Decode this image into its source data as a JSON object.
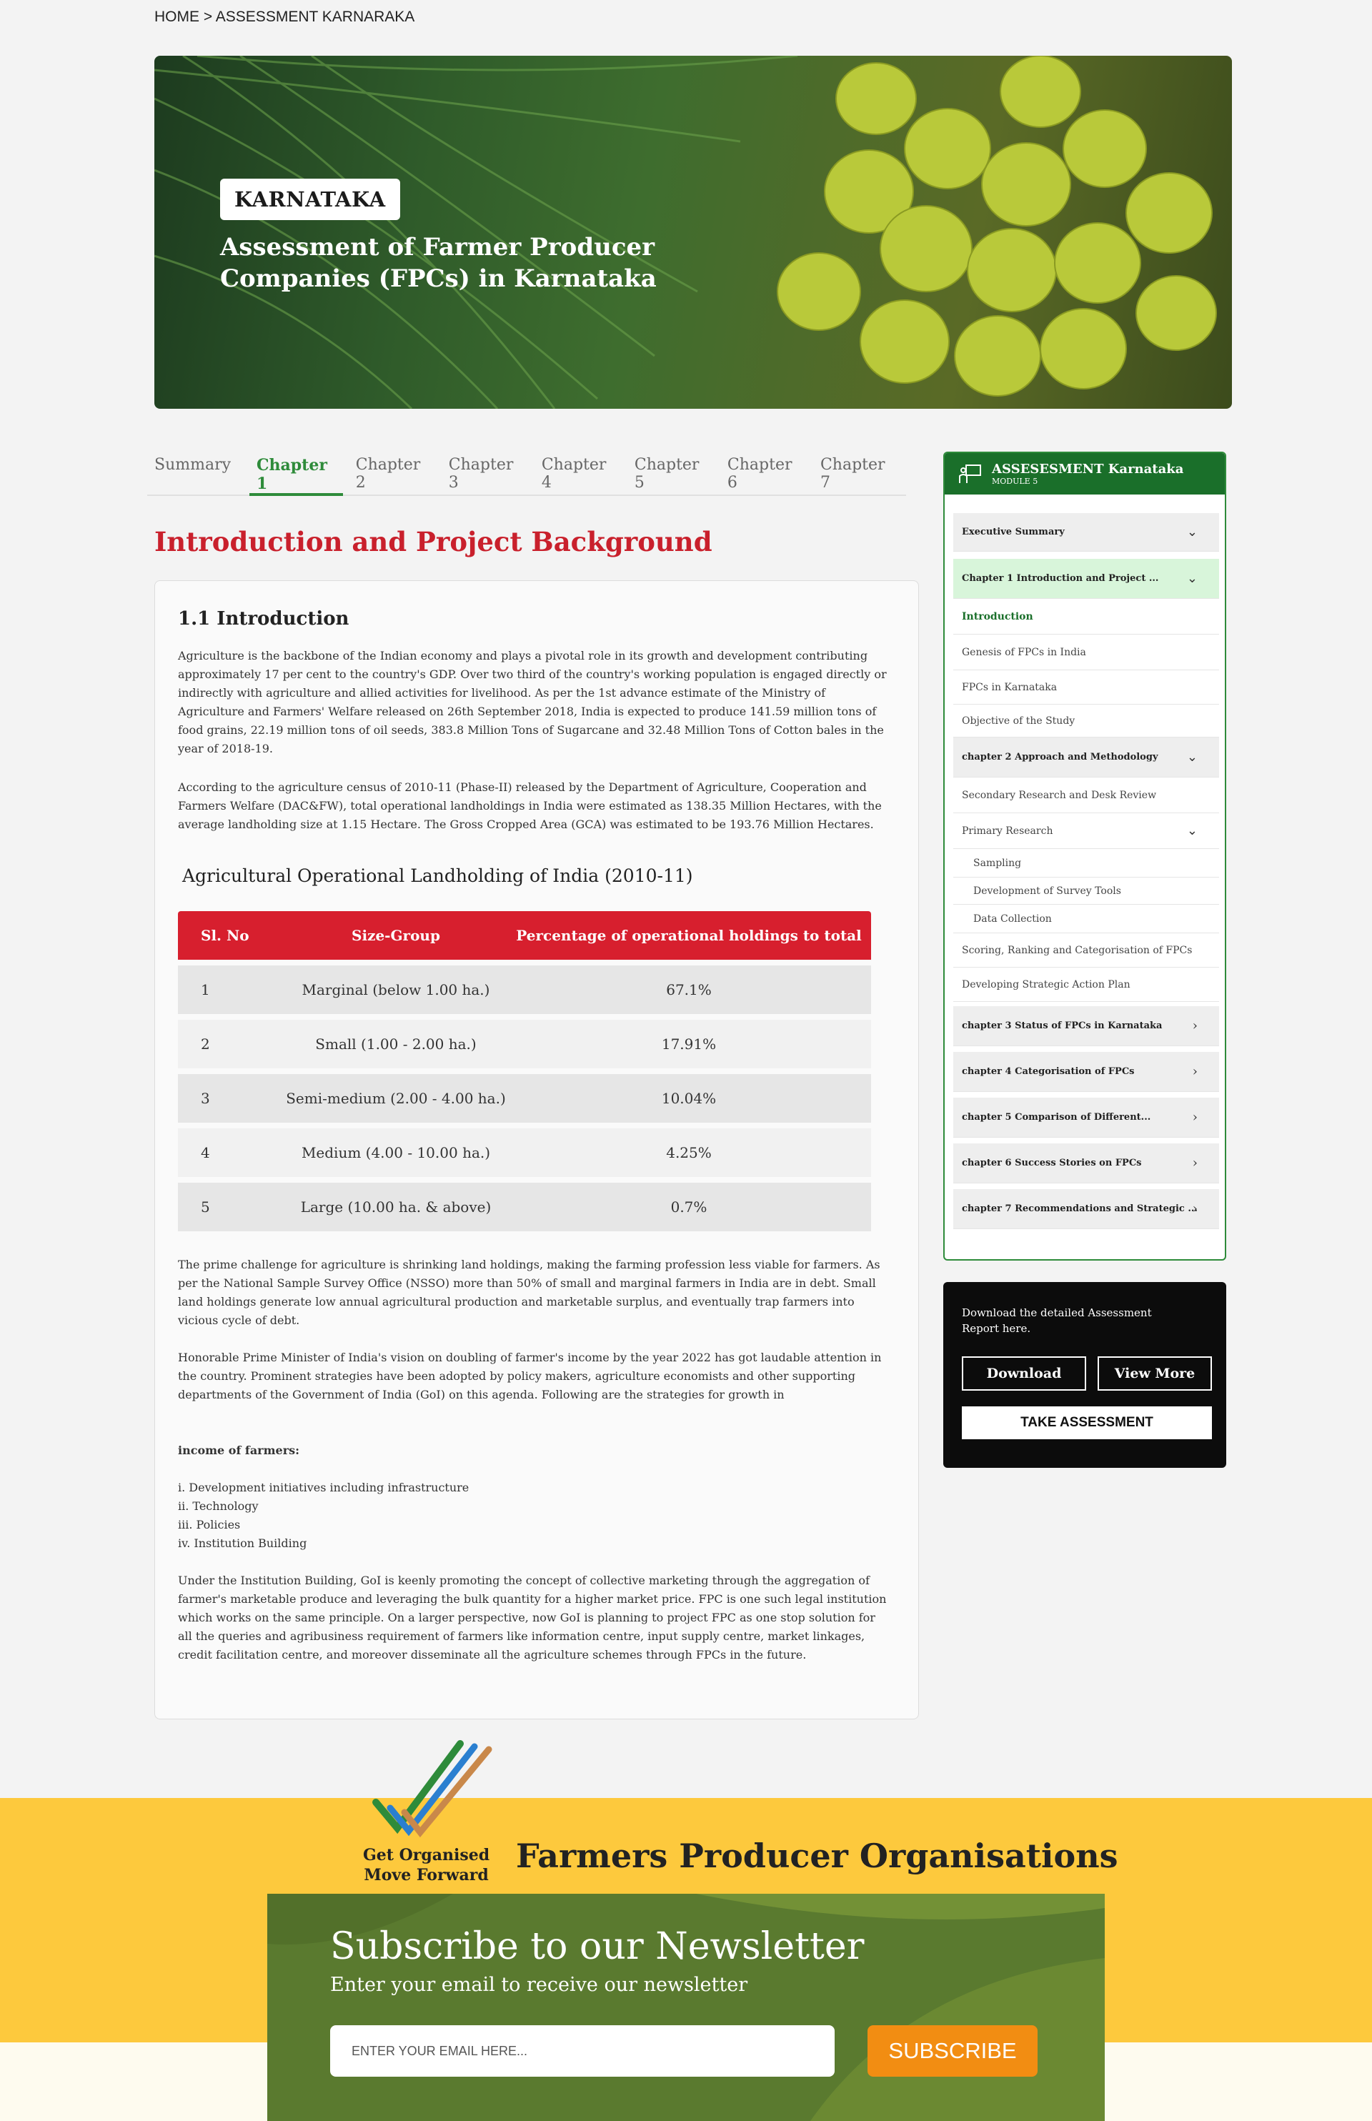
{
  "breadcrumb": {
    "home": "HOME",
    "separator": " > ",
    "current": "ASSESSMENT KARNARAKA"
  },
  "hero": {
    "tag": "KARNATAKA",
    "title": "Assessment of Farmer Producer Companies (FPCs) in Karnataka"
  },
  "tabs": [
    {
      "label": "Summary"
    },
    {
      "label": "Chapter 1"
    },
    {
      "label": "Chapter 2"
    },
    {
      "label": "Chapter 3"
    },
    {
      "label": "Chapter 4"
    },
    {
      "label": "Chapter 5"
    },
    {
      "label": "Chapter 6"
    },
    {
      "label": "Chapter 7"
    }
  ],
  "active_tab": "Chapter 1",
  "main": {
    "section_title": "Introduction and Project Background",
    "subtitle": "1.1 Introduction",
    "para1": "Agriculture is the backbone of the Indian economy and plays a pivotal role in its growth and development contributing approximately 17 per cent to the country's GDP. Over two third of the country's working population is engaged directly or indirectly with agriculture and allied activities for livelihood. As per the 1st advance estimate of the Ministry of Agriculture and Farmers' Welfare released on 26th September 2018, India is expected to produce 141.59 million tons of food grains, 22.19 million tons of oil seeds, 383.8 Million Tons of Sugarcane and 32.48 Million Tons of Cotton bales in the year of 2018-19.",
    "para2": "According to the agriculture census of 2010-11 (Phase-II) released by the Department of Agriculture, Cooperation and Farmers Welfare (DAC&FW), total operational landholdings in India were estimated as 138.35 Million Hectares, with the average landholding size at 1.15 Hectare. The Gross Cropped Area (GCA) was estimated to be 193.76 Million Hectares.",
    "table_title": "Agricultural Operational Landholding of India (2010-11)",
    "table": {
      "headers": [
        "Sl. No",
        "Size-Group",
        "Percentage of operational holdings to total"
      ],
      "rows": [
        [
          "1",
          "Marginal (below 1.00 ha.)",
          "67.1%"
        ],
        [
          "2",
          "Small (1.00 - 2.00 ha.)",
          "17.91%"
        ],
        [
          "3",
          "Semi-medium (2.00 - 4.00 ha.)",
          "10.04%"
        ],
        [
          "4",
          "Medium (4.00 - 10.00 ha.)",
          "4.25%"
        ],
        [
          "5",
          "Large (10.00 ha. & above)",
          "0.7%"
        ]
      ]
    },
    "para3": "The prime challenge for agriculture is shrinking land holdings, making the farming profession less viable for farmers. As per the National Sample Survey Office (NSSO) more than 50% of small and marginal farmers in India are in debt. Small land holdings generate low annual agricultural production and marketable surplus, and eventually trap farmers into vicious cycle of debt.",
    "para4": "Honorable Prime Minister of India's vision on doubling of farmer's income by the year 2022 has got laudable attention in the country. Prominent strategies have been adopted by policy makers, agriculture economists and other supporting departments of the Government of India (GoI) on this agenda. Following are the strategies for growth in",
    "income_heading": "income of farmers:",
    "strategies": [
      "i.  Development initiatives including infrastructure",
      "ii. Technology",
      "iii. Policies",
      "iv. Institution Building"
    ],
    "para5": "Under the Institution Building, GoI is keenly promoting the concept of collective marketing through the aggregation of farmer's marketable produce and leveraging the bulk quantity for a higher market price. FPC is one such legal institution which works on the same principle. On a larger perspective, now GoI is planning to project FPC as one stop solution for all the queries and agribusiness requirement of farmers like information centre, input supply centre, market linkages, credit facilitation centre, and moreover disseminate all the agriculture schemes through FPCs in the future."
  },
  "sidebar": {
    "title": "ASSESESMENT Karnataka",
    "subtitle": "MODULE 5",
    "items": [
      {
        "label": "Executive Summary"
      },
      {
        "label": "Chapter 1 Introduction and Project ..."
      },
      {
        "label": "Introduction"
      },
      {
        "label": "Genesis of FPCs in India"
      },
      {
        "label": "FPCs in Karnataka"
      },
      {
        "label": "Objective of the Study"
      },
      {
        "label": "chapter 2  Approach and Methodology"
      },
      {
        "label": "Secondary Research and Desk Review"
      },
      {
        "label": "Primary Research"
      },
      {
        "label": "Sampling"
      },
      {
        "label": "Development of Survey Tools"
      },
      {
        "label": "Data Collection"
      },
      {
        "label": "Scoring, Ranking and Categorisation of FPCs"
      },
      {
        "label": "Developing Strategic Action Plan"
      },
      {
        "label": "chapter 3  Status of FPCs in Karnataka"
      },
      {
        "label": "chapter 4  Categorisation of FPCs"
      },
      {
        "label": "chapter 5  Comparison of Different..."
      },
      {
        "label": "chapter 6  Success Stories on FPCs"
      },
      {
        "label": "chapter 7  Recommendations and Strategic ..."
      }
    ]
  },
  "download": {
    "text": "Download the detailed Assessment Report here.",
    "download_label": "Download",
    "view_more_label": "View More",
    "take_assessment_label": "TAKE ASSESSMENT"
  },
  "footer": {
    "tagline_line1": "Get Organised",
    "tagline_line2": "Move Forward",
    "org_title": "Farmers Producer Organisations",
    "newsletter_title": "Subscribe to our Newsletter",
    "newsletter_sub": "Enter your email to receive our newsletter",
    "email_placeholder": "ENTER YOUR EMAIL HERE...",
    "subscribe_label": "SUBSCRIBE"
  },
  "colors": {
    "brand_green": "#1a6f2a",
    "accent_red": "#c9202c",
    "table_red": "#d71f2e",
    "footer_yellow": "#fdc93d",
    "subscribe_orange": "#f28d12"
  }
}
